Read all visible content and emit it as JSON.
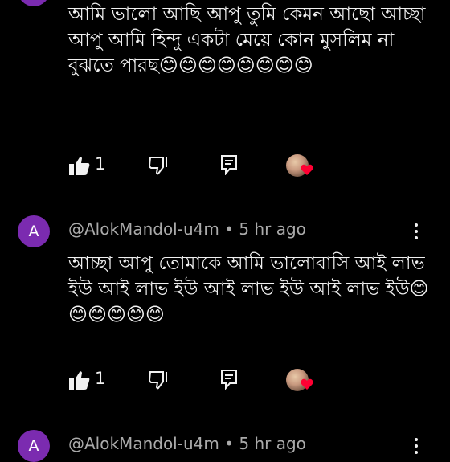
{
  "comments": [
    {
      "text": "আমি ভালো আছি আপু তুমি কেমন আছো আচ্ছা আপু আমি হিন্দু একটা মেয়ে কোন মুসলিম না বুঝতে পারছ😊😊😊😊😊😊😊😊",
      "likes": "1"
    },
    {
      "avatar_letter": "A",
      "author": "@AlokMandol-u4m",
      "time": "5 hr ago",
      "text": "আচ্ছা আপু তোমাকে আমি ভালোবাসি আই লাভ ইউ আই লাভ ইউ আই লাভ ইউ আই লাভ ইউ😊😊😊😊😊😊",
      "likes": "1"
    },
    {
      "avatar_letter": "A",
      "author": "@AlokMandol-u4m",
      "time": "5 hr ago"
    }
  ],
  "meta_separator": "•",
  "icons": {
    "like": "thumbs-up-icon",
    "dislike": "thumbs-down-icon",
    "reply": "reply-icon",
    "more": "more-vert-icon",
    "creator_heart": "heart-icon"
  },
  "colors": {
    "background": "#000000",
    "text": "#f1f1f1",
    "meta": "#aaaaaa",
    "avatar": "#7b2bb0",
    "heart": "#ff0033"
  }
}
